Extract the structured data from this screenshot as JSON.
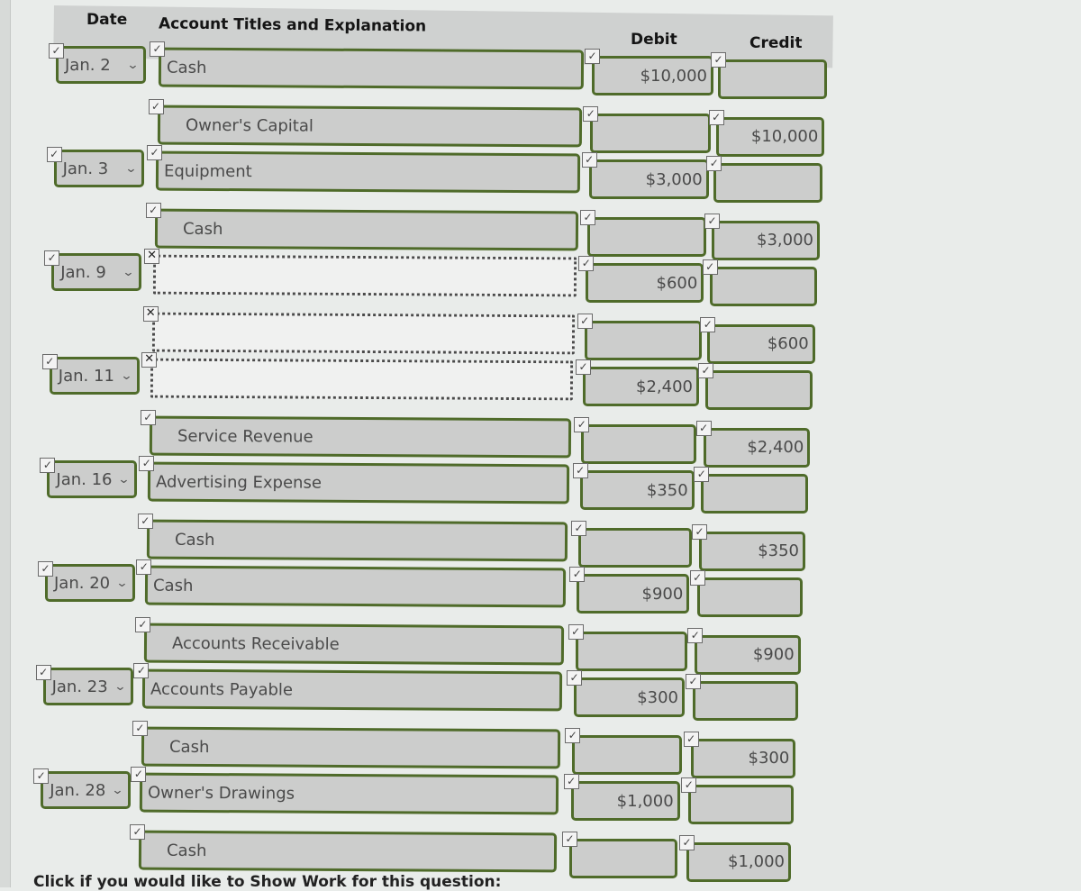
{
  "headers": {
    "date": "Date",
    "account": "Account Titles and Explanation",
    "debit": "Debit",
    "credit": "Credit"
  },
  "icons": {
    "check": "✓",
    "cross": "✕",
    "chevron": "⌄"
  },
  "rows": [
    {
      "date": "Jan. 2",
      "account": "Cash",
      "indent": false,
      "debit": "$10,000",
      "credit": "",
      "status": "correct"
    },
    {
      "date": "",
      "account": "Owner's Capital",
      "indent": true,
      "debit": "",
      "credit": "$10,000",
      "status": "correct"
    },
    {
      "date": "Jan. 3",
      "account": "Equipment",
      "indent": false,
      "debit": "$3,000",
      "credit": "",
      "status": "correct"
    },
    {
      "date": "",
      "account": "Cash",
      "indent": true,
      "debit": "",
      "credit": "$3,000",
      "status": "correct"
    },
    {
      "date": "Jan. 9",
      "account": "",
      "indent": false,
      "debit": "$600",
      "credit": "",
      "status": "incorrect"
    },
    {
      "date": "",
      "account": "",
      "indent": true,
      "debit": "",
      "credit": "$600",
      "status": "incorrect"
    },
    {
      "date": "Jan. 11",
      "account": "",
      "indent": false,
      "debit": "$2,400",
      "credit": "",
      "status": "incorrect"
    },
    {
      "date": "",
      "account": "Service Revenue",
      "indent": true,
      "debit": "",
      "credit": "$2,400",
      "status": "correct"
    },
    {
      "date": "Jan. 16",
      "account": "Advertising Expense",
      "indent": false,
      "debit": "$350",
      "credit": "",
      "status": "correct"
    },
    {
      "date": "",
      "account": "Cash",
      "indent": true,
      "debit": "",
      "credit": "$350",
      "status": "correct"
    },
    {
      "date": "Jan. 20",
      "account": "Cash",
      "indent": false,
      "debit": "$900",
      "credit": "",
      "status": "correct"
    },
    {
      "date": "",
      "account": "Accounts Receivable",
      "indent": true,
      "debit": "",
      "credit": "$900",
      "status": "correct"
    },
    {
      "date": "Jan. 23",
      "account": "Accounts Payable",
      "indent": false,
      "debit": "$300",
      "credit": "",
      "status": "correct"
    },
    {
      "date": "",
      "account": "Cash",
      "indent": true,
      "debit": "",
      "credit": "$300",
      "status": "correct"
    },
    {
      "date": "Jan. 28",
      "account": "Owner's Drawings",
      "indent": false,
      "debit": "$1,000",
      "credit": "",
      "status": "correct"
    },
    {
      "date": "",
      "account": "Cash",
      "indent": true,
      "debit": "",
      "credit": "$1,000",
      "status": "correct"
    }
  ],
  "footer": {
    "text": "Click if you would like to Show Work for this question:"
  }
}
